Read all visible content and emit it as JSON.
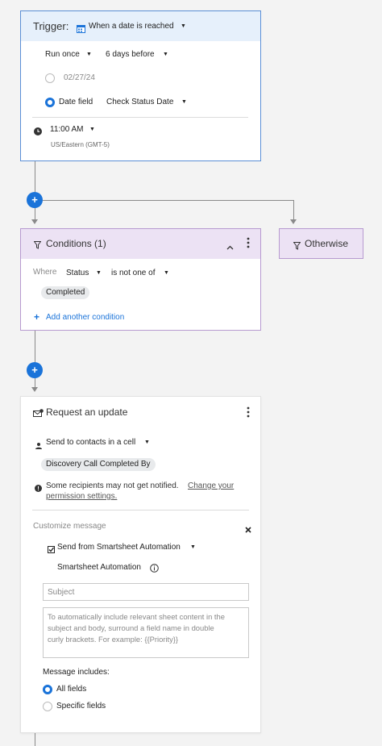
{
  "trigger": {
    "label": "Trigger:",
    "type": "When a date is reached",
    "frequency": "Run once",
    "offset": "6 days before",
    "date_value": "02/27/24",
    "date_field_label": "Date field",
    "date_field_value": "Check Status Date",
    "time": "11:00 AM",
    "timezone": "US/Eastern (GMT-5)"
  },
  "conditions": {
    "title": "Conditions (1)",
    "where_label": "Where",
    "field": "Status",
    "operator": "is not one of",
    "value": "Completed",
    "add_condition": "Add another condition"
  },
  "otherwise": {
    "label": "Otherwise"
  },
  "request": {
    "title": "Request an update",
    "send_to": "Send to contacts in a cell",
    "contact_column": "Discovery Call Completed By",
    "warning_text": "Some recipients may not get notified.",
    "warning_link_1": "Change your",
    "warning_link_2": "permission settings.",
    "customize_label": "Customize message",
    "send_from": "Send from Smartsheet Automation",
    "sender_name": "Smartsheet Automation",
    "subject_placeholder": "Subject",
    "body_placeholder_line1": "To automatically include relevant sheet content in the",
    "body_placeholder_line2": "subject and body, surround a field name in double",
    "body_placeholder_line3": "curly brackets. For example: {{Priority}}",
    "includes_label": "Message includes:",
    "option_all": "All fields",
    "option_specific": "Specific fields"
  },
  "colors": {
    "accent": "#1a73d9",
    "trigger_header": "#e6f0fb",
    "condition_header": "#ece2f4"
  }
}
